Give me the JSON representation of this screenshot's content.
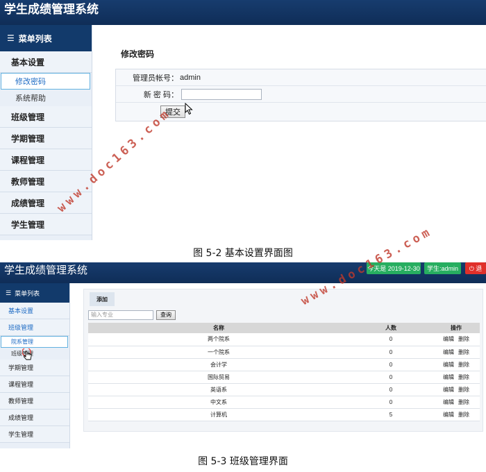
{
  "figure1": {
    "app_title": "学生成绩管理系统",
    "menu_header": "菜单列表",
    "menu": [
      {
        "label": "基本设置",
        "children": [
          "修改密码",
          "系统帮助"
        ]
      },
      {
        "label": "班级管理"
      },
      {
        "label": "学期管理"
      },
      {
        "label": "课程管理"
      },
      {
        "label": "教师管理"
      },
      {
        "label": "成绩管理"
      },
      {
        "label": "学生管理"
      }
    ],
    "active_item": "修改密码",
    "content_title": "修改密码",
    "account_label": "管理员帐号：",
    "account_value": "admin",
    "new_password_label": "新 密 码：",
    "new_password_value": "",
    "submit_label": "提交",
    "caption": "图 5-2 基本设置界面图"
  },
  "figure2": {
    "app_title": "学生成绩管理系统",
    "badges": [
      {
        "text": "今天是 2019-12-30",
        "color": "#27ae60"
      },
      {
        "text": "学生:admin",
        "color": "#27ae60"
      },
      {
        "text": "⏻ 退",
        "color": "#e0302a"
      }
    ],
    "menu_header": "菜单列表",
    "menu": [
      {
        "label": "基本设置"
      },
      {
        "label": "班级管理",
        "children": [
          "院系管理",
          "班级管理"
        ]
      },
      {
        "label": "学期管理"
      },
      {
        "label": "课程管理"
      },
      {
        "label": "教师管理"
      },
      {
        "label": "成绩管理"
      },
      {
        "label": "学生管理"
      }
    ],
    "tab_label": "添加",
    "search_placeholder": "输入专业",
    "search_button": "查询",
    "table_headers": [
      "名称",
      "人数",
      "操作"
    ],
    "rows": [
      {
        "name": "两个院系",
        "count": "0"
      },
      {
        "name": "一个院系",
        "count": "0"
      },
      {
        "name": "会计学",
        "count": "0"
      },
      {
        "name": "国际贸易",
        "count": "0"
      },
      {
        "name": "英语系",
        "count": "0"
      },
      {
        "name": "中文系",
        "count": "0"
      },
      {
        "name": "计算机",
        "count": "5"
      }
    ],
    "row_actions": [
      "编辑",
      "删除"
    ],
    "caption": "图 5-3 班级管理界面"
  },
  "watermark": "www.doc163.com"
}
